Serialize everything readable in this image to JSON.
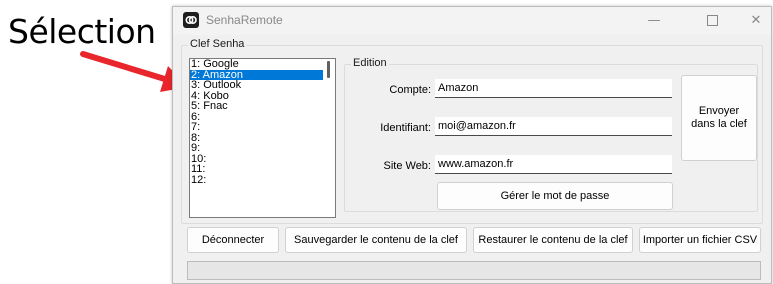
{
  "annotation": {
    "label": "Sélection"
  },
  "window": {
    "title": "SenhaRemote",
    "controls": {
      "minimize": "—",
      "close": "✕"
    }
  },
  "group_clef": {
    "legend": "Clef Senha",
    "list": {
      "selected_index": 1,
      "items": [
        "1: Google",
        "2: Amazon",
        "3: Outlook",
        "4: Kobo",
        "5: Fnac",
        "6:",
        "7:",
        "8:",
        "9:",
        "10:",
        "11:",
        "12:"
      ]
    }
  },
  "edition": {
    "legend": "Edition",
    "compte_label": "Compte:",
    "compte_value": "Amazon",
    "identifiant_label": "Identifiant:",
    "identifiant_value": "moi@amazon.fr",
    "siteweb_label": "Site Web:",
    "siteweb_value": "www.amazon.fr",
    "envoyer_line1": "Envoyer",
    "envoyer_line2": "dans la clef",
    "gerer_label": "Gérer le mot de passe"
  },
  "actions": {
    "deconnecter": "Déconnecter",
    "sauvegarder": "Sauvegarder le contenu de la clef",
    "restaurer": "Restaurer le contenu de la clef",
    "importer": "Importer un fichier CSV"
  },
  "colors": {
    "selection": "#0078d7",
    "arrow": "#e8262b",
    "window_bg": "#f0f0f0"
  },
  "icons": {
    "app": "app-logo-icon",
    "arrow": "red-arrow-annotation"
  }
}
